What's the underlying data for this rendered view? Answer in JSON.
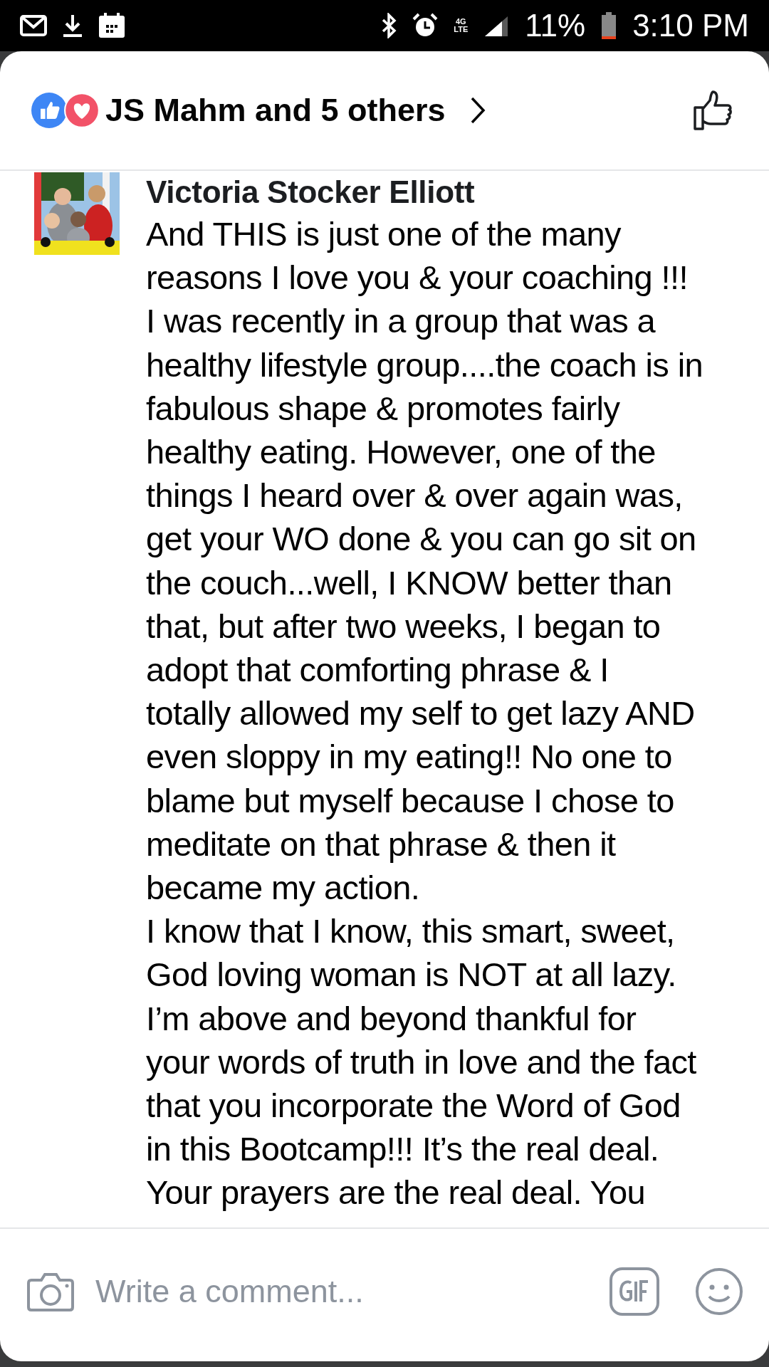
{
  "status_bar": {
    "network": [
      "4G",
      "LTE"
    ],
    "battery": "11%",
    "time": "3:10 PM"
  },
  "reactions": {
    "summary": "JS Mahm and 5 others",
    "liked": false
  },
  "comment": {
    "author": "Victoria Stocker Elliott",
    "avatar": {
      "kind": "picture"
    },
    "paragraphs": [
      [
        "And THIS is just one of the many",
        "reasons I love you & your coaching !!!"
      ],
      [
        "I was recently in a group that was a",
        "healthy lifestyle group....the coach is in",
        "fabulous shape & promotes fairly",
        "healthy eating. However, one of the",
        "things I heard over & over again was,",
        "get your WO done & you can go sit on",
        "the couch...well, I KNOW better than",
        "that, but after two weeks, I began to",
        "adopt that comforting phrase & I",
        "totally allowed my self to get lazy AND",
        "even sloppy in my eating!! No one to",
        "blame but myself because I chose to",
        "meditate on that phrase & then it",
        "became my action."
      ],
      [
        "I know that I know, this smart, sweet,",
        "God loving woman is NOT at all lazy.",
        "I’m  above and beyond thankful for",
        "your words of truth in love and the fact",
        "that you incorporate the Word of God",
        "in this Bootcamp!!! It’s the real deal.",
        "Your prayers are the real deal. You"
      ]
    ]
  },
  "composer": {
    "placeholder": "Write a comment..."
  }
}
